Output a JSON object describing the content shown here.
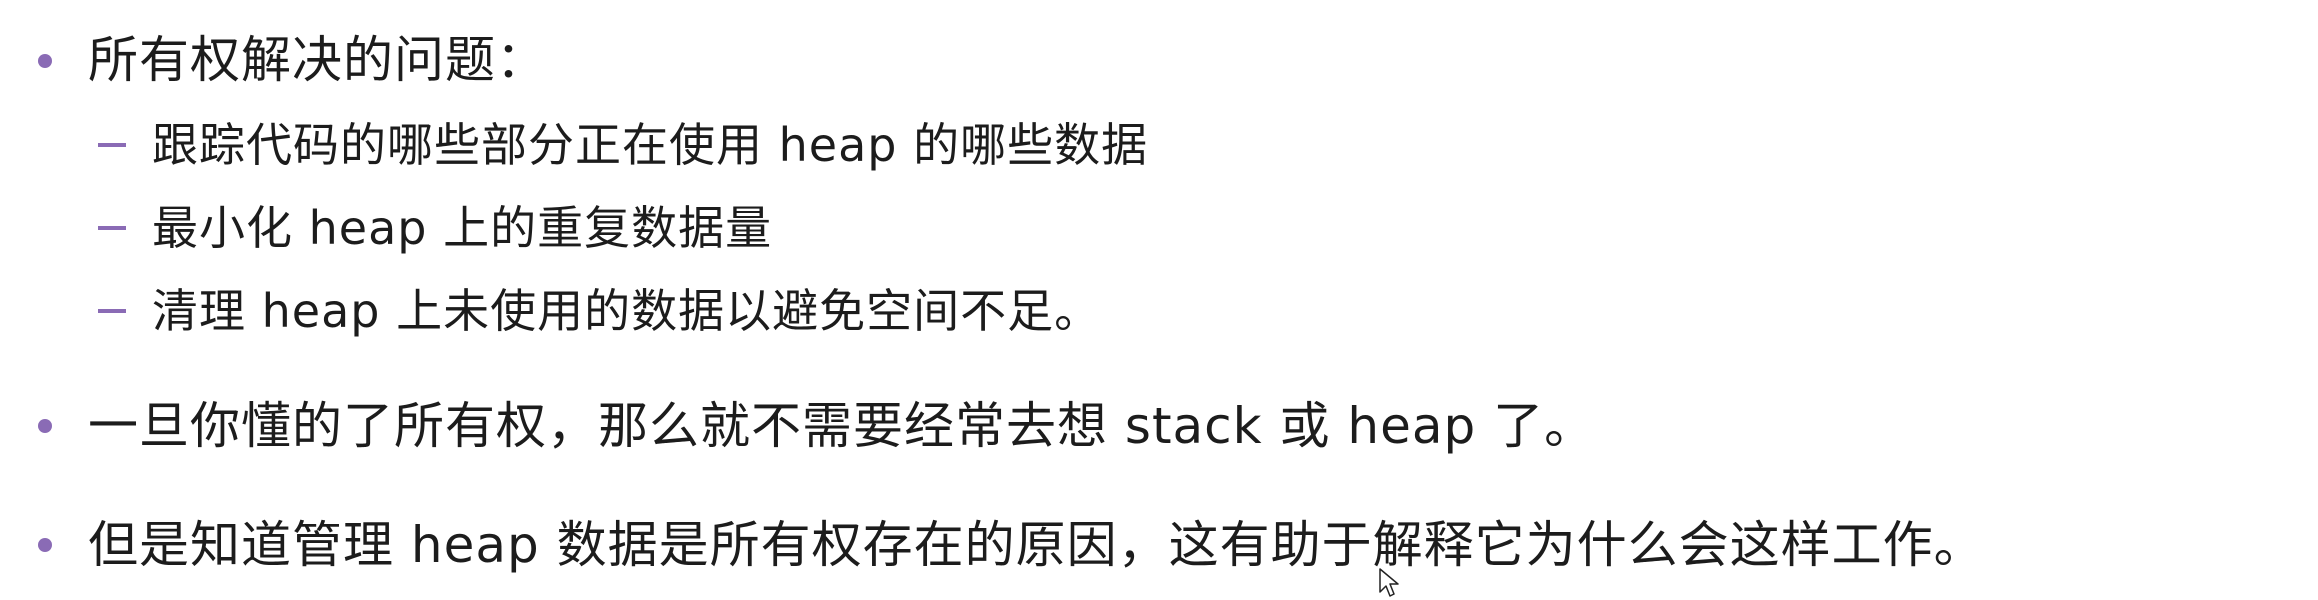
{
  "bullets": [
    {
      "text": "所有权解决的问题：",
      "sub_items": [
        "跟踪代码的哪些部分正在使用 heap 的哪些数据",
        "最小化 heap 上的重复数据量",
        "清理 heap 上未使用的数据以避免空间不足。"
      ]
    },
    {
      "text": "一旦你懂的了所有权，那么就不需要经常去想 stack 或 heap 了。"
    },
    {
      "text": "但是知道管理 heap 数据是所有权存在的原因，这有助于解释它为什么会这样工作。"
    }
  ],
  "colors": {
    "bullet": "#8a6bb5",
    "text": "#1c1c1c",
    "background": "#ffffff"
  },
  "icons": {
    "cursor": "mouse-pointer-icon"
  }
}
